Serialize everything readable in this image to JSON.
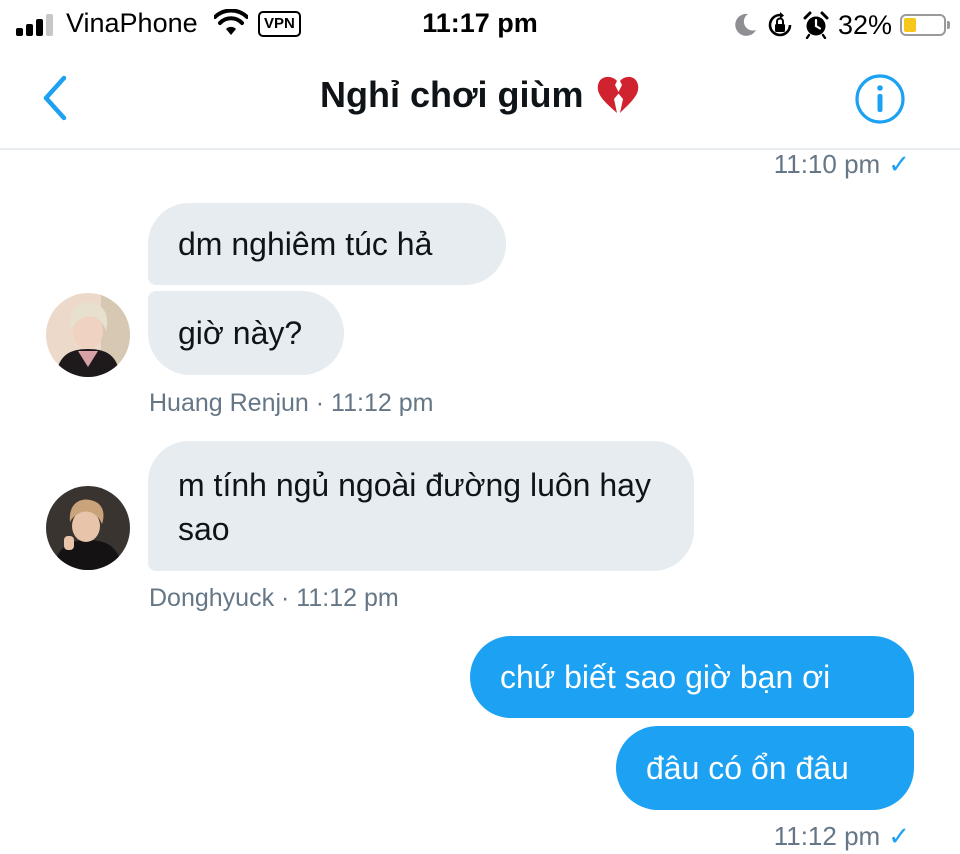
{
  "status_bar": {
    "carrier": "VinaPhone",
    "vpn_label": "VPN",
    "time": "11:17 pm",
    "battery_percent": "32%",
    "battery_level": 0.32,
    "battery_color": "#f7c81b",
    "icons": [
      "signal-bars-icon",
      "wifi-icon",
      "moon-icon",
      "orientation-lock-icon",
      "alarm-icon",
      "battery-icon"
    ]
  },
  "header": {
    "title": "Nghỉ chơi giùm",
    "title_emoji": "broken-heart-icon",
    "back_icon": "chevron-left-icon",
    "info_icon": "info-icon"
  },
  "conversation": {
    "top_timestamp": "11:10 pm",
    "messages_group1": [
      "dm nghiêm túc hả",
      "giờ này?"
    ],
    "meta1": "Huang Renjun · 11:12 pm",
    "message2": "m tính ngủ ngoài đường luôn hay sao",
    "meta2": "Donghyuck · 11:12 pm",
    "outgoing": [
      "chứ biết sao giờ bạn ơi",
      "đâu có ổn đâu"
    ],
    "bottom_timestamp": "11:12 pm",
    "read_check": "✓"
  },
  "colors": {
    "accent": "#1da1f2",
    "incoming_bubble": "#e6ecf0",
    "muted_text": "#657786"
  }
}
